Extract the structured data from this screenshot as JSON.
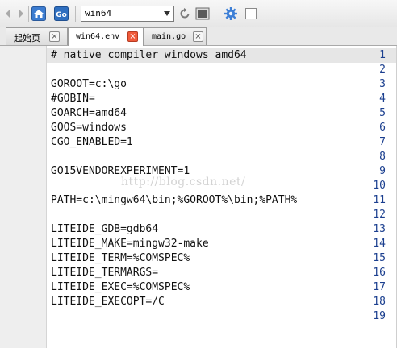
{
  "toolbar": {
    "build_config": "win64",
    "colors": {
      "go_button_bg": "#2f6fc0",
      "home_button_bg": "#3c7cd0",
      "gear": "#3d7fd6"
    }
  },
  "tabs": [
    {
      "label": "起始页",
      "active": false
    },
    {
      "label": "win64.env",
      "active": true
    },
    {
      "label": "main.go",
      "active": false
    }
  ],
  "tab_close_glyph": "×",
  "editor": {
    "line_numbers": [
      "1",
      "2",
      "3",
      "4",
      "5",
      "6",
      "7",
      "8",
      "9",
      "10",
      "11",
      "12",
      "13",
      "14",
      "15",
      "16",
      "17",
      "18",
      "19"
    ],
    "lines": [
      "# native compiler windows amd64",
      "",
      "GOROOT=c:\\go",
      "#GOBIN=",
      "GOARCH=amd64",
      "GOOS=windows",
      "CGO_ENABLED=1",
      "",
      "GO15VENDOREXPERIMENT=1",
      "",
      "PATH=c:\\mingw64\\bin;%GOROOT%\\bin;%PATH%",
      "",
      "LITEIDE_GDB=gdb64",
      "LITEIDE_MAKE=mingw32-make",
      "LITEIDE_TERM=%COMSPEC%",
      "LITEIDE_TERMARGS=",
      "LITEIDE_EXEC=%COMSPEC%",
      "LITEIDE_EXECOPT=/C",
      ""
    ],
    "watermark": "http://blog.csdn.net/"
  }
}
